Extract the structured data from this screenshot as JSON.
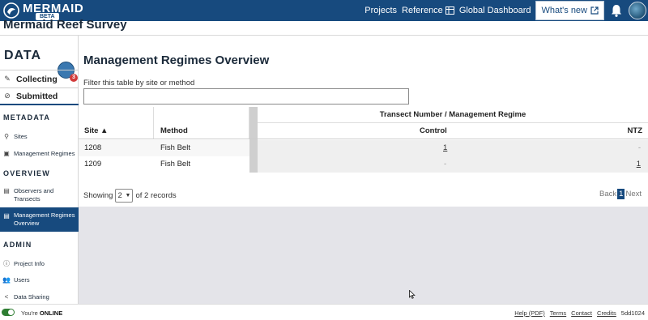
{
  "topbar": {
    "brand_name": "MERMAID",
    "brand_badge": "BETA",
    "nav": {
      "projects": "Projects",
      "reference": "Reference",
      "global_dashboard": "Global Dashboard",
      "whats_new": "What's new"
    }
  },
  "project": {
    "title": "Mermaid Reef Survey"
  },
  "sidebar": {
    "data_heading": "DATA",
    "collecting": "Collecting",
    "collecting_badge": "3",
    "submitted": "Submitted",
    "metadata_heading": "METADATA",
    "sites": "Sites",
    "management_regimes": "Management Regimes",
    "overview_heading": "OVERVIEW",
    "observers_line1": "Observers and",
    "observers_line2": "Transects",
    "mr_overview_line1": "Management Regimes",
    "mr_overview_line2": "Overview",
    "admin_heading": "ADMIN",
    "project_info": "Project Info",
    "users": "Users",
    "data_sharing": "Data Sharing"
  },
  "main": {
    "title": "Management Regimes Overview",
    "filter_label": "Filter this table by site or method",
    "filter_value": "",
    "table": {
      "group_header": "Transect Number / Management Regime",
      "columns": {
        "site": "Site ▲",
        "method": "Method",
        "control": "Control",
        "ntz": "NTZ"
      },
      "rows": [
        {
          "site": "1208",
          "method": "Fish Belt",
          "control": "1",
          "ntz": "-"
        },
        {
          "site": "1209",
          "method": "Fish Belt",
          "control": "-",
          "ntz": "1"
        }
      ]
    },
    "showing_prefix": "Showing",
    "page_size": "2",
    "showing_suffix": "of 2 records",
    "pager": {
      "back": "Back",
      "current": "1",
      "next": "Next"
    }
  },
  "footer": {
    "status_prefix": "You're",
    "status_value": "ONLINE",
    "links": {
      "help": "Help (PDF)",
      "terms": "Terms",
      "contact": "Contact",
      "credits": "Credits"
    },
    "version": "5dd1024"
  },
  "colors": {
    "brand": "#174a7e",
    "badge": "#d23a3a",
    "online": "#2e7d32",
    "grey_area": "#e4e4e9"
  },
  "icons": [
    "mermaid-logo-icon",
    "external-link-icon",
    "bell-icon",
    "avatar",
    "collecting-icon",
    "submitted-icon",
    "sites-icon",
    "management-regimes-icon",
    "observers-icon",
    "overview-icon",
    "project-info-icon",
    "users-icon",
    "data-sharing-icon",
    "chevron-down-icon",
    "sync-icon"
  ]
}
